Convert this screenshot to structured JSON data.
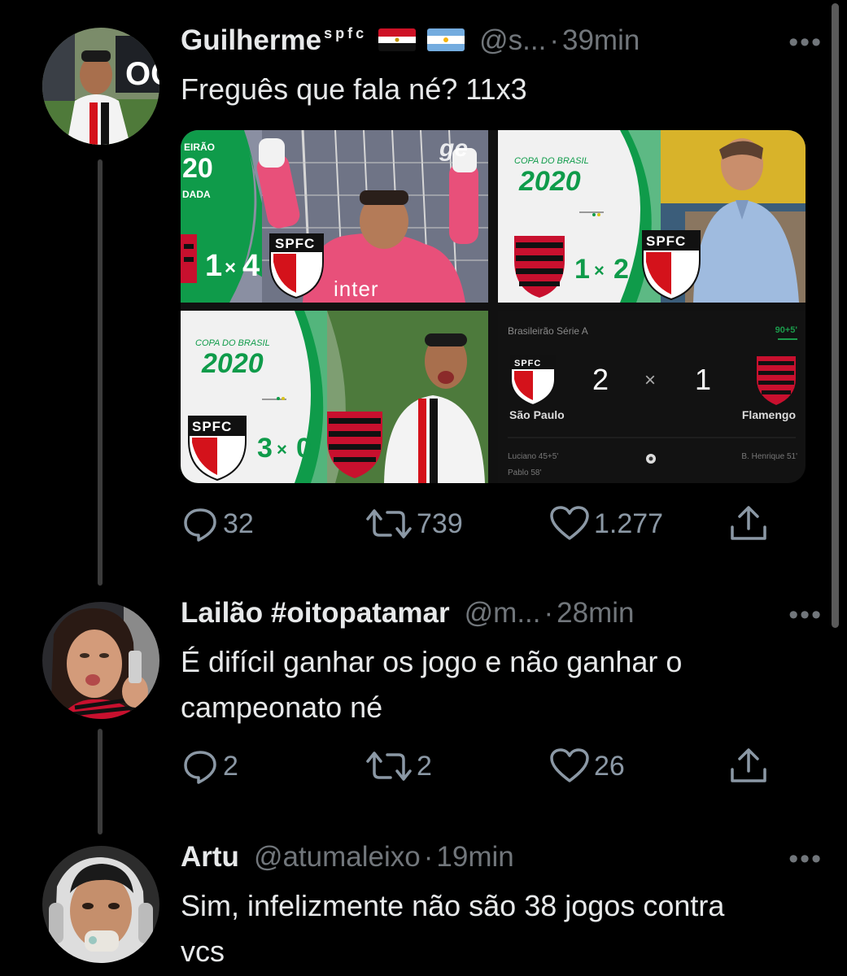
{
  "tweets": [
    {
      "name": "Guilherme",
      "name_sup": "spfc",
      "handle": "@s...",
      "sep": "·",
      "time": "39min",
      "more": "•••",
      "text": "Freguês que fala né? 11x3",
      "replies": "32",
      "retweets": "739",
      "likes": "1.277"
    },
    {
      "name": "Lailão #oitopatamar",
      "handle": "@m...",
      "sep": "·",
      "time": "28min",
      "more": "•••",
      "text": "É difícil ganhar os jogo e não ganhar o campeonato né",
      "replies": "2",
      "retweets": "2",
      "likes": "26"
    },
    {
      "name": "Artu",
      "handle": "@atumaleixo",
      "sep": "·",
      "time": "19min",
      "more": "•••",
      "text": "Sim, infelizmente não são 38 jogos contra vcs"
    }
  ],
  "media": {
    "tile1": {
      "competition_a": "EIRÃO",
      "competition_b": "20",
      "round": "DADA",
      "score_left": "1",
      "score_x": "×",
      "score_right": "4",
      "badge": "SPFC",
      "sponsor": "inter",
      "watermark": "ge"
    },
    "tile2": {
      "competition": "COPA DO BRASIL",
      "year": "2020",
      "score_left": "1",
      "score_x": "×",
      "score_right": "2",
      "badge": "SPFC"
    },
    "tile3": {
      "competition": "COPA DO BRASIL",
      "year": "2020",
      "score_left": "3",
      "score_x": "×",
      "score_right": "0",
      "badge": "SPFC"
    },
    "tile4": {
      "league": "Brasileirão Série A",
      "clock": "90+5'",
      "home_badge": "SPFC",
      "home": "São Paulo",
      "away": "Flamengo",
      "home_score": "2",
      "score_x": "×",
      "away_score": "1",
      "home_scorers": [
        "Luciano 45+5'",
        "Pablo 58'"
      ],
      "away_scorers": [
        "B. Henrique 51'"
      ]
    }
  },
  "colors": {
    "background": "#000000",
    "text": "#e7e9ea",
    "muted": "#71767b",
    "spfc_red": "#d4121b",
    "fla_red": "#c8102e",
    "copa_green": "#0f9b4a",
    "score_green": "#1b9a4b"
  },
  "icons": [
    "reply-icon",
    "retweet-icon",
    "like-icon",
    "share-icon",
    "more-icon"
  ]
}
